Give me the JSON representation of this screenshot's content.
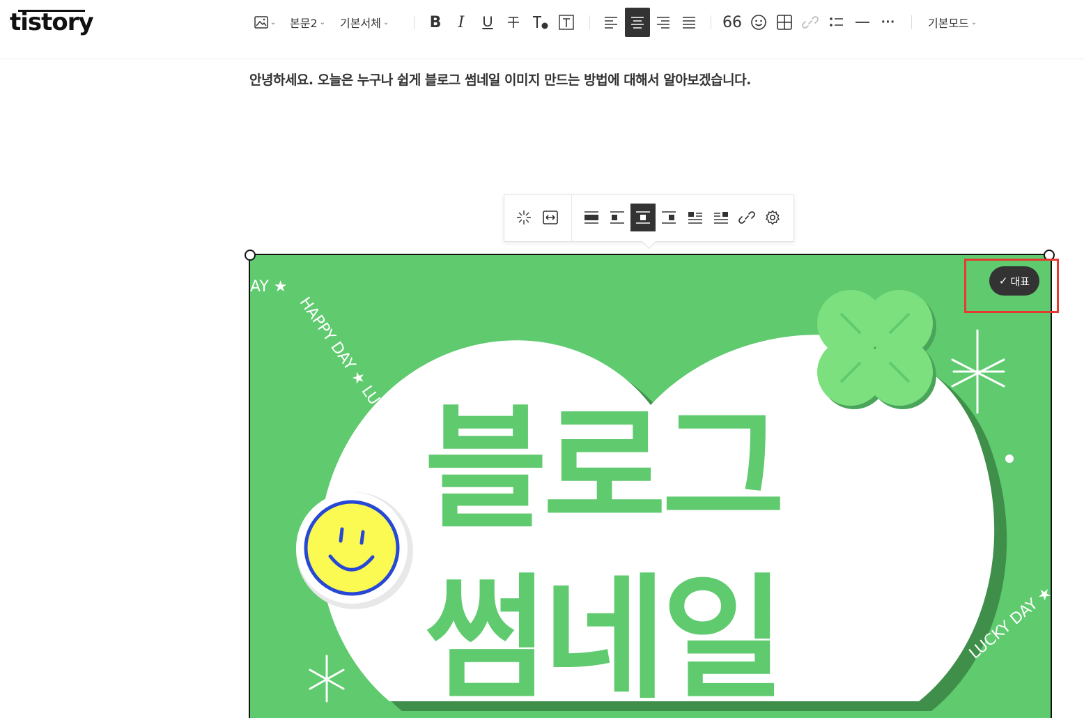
{
  "logo": "tistory",
  "toolbar": {
    "paragraph_style": "본문2",
    "font": "기본서체",
    "mode": "기본모드",
    "quote_label": "66",
    "more_label": "···"
  },
  "intro_text": "안녕하세요. 오늘은 누구나 쉽게 블로그 썸네일 이미지 만드는 방법에 대해서 알아보겠습니다.",
  "image": {
    "title_line1": "블로그",
    "title_line2": "썸네일",
    "ring_top": "HAPPY DAY ★ LUCKY",
    "ring_bottom": "LUCKY DAY ★",
    "ring_fragment": "AY ★"
  },
  "representative_badge": {
    "check": "✓",
    "label": "대표"
  },
  "colors": {
    "image_bg": "#5fca6e",
    "highlight": "#e53a2f",
    "active_button": "#333333"
  }
}
